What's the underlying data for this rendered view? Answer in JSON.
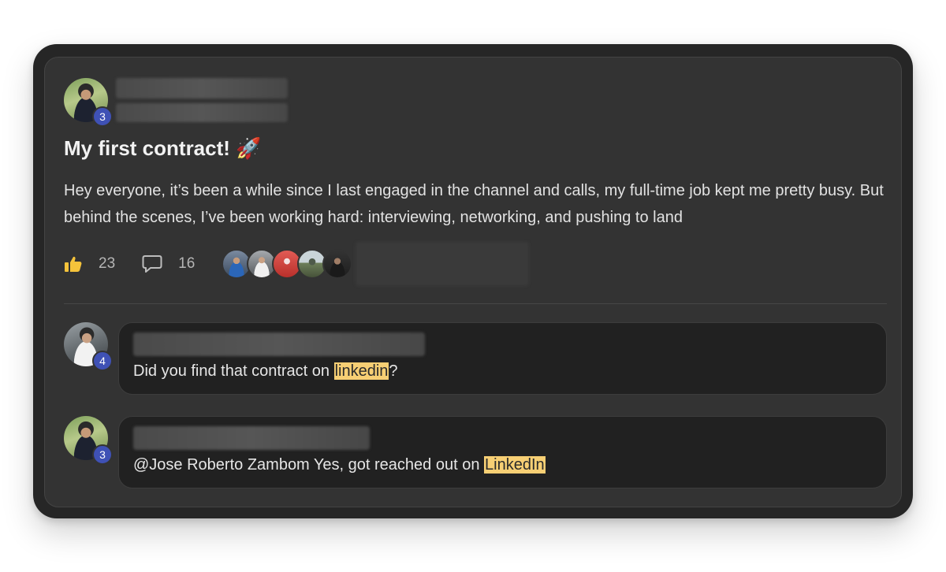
{
  "post": {
    "author_badge": "3",
    "title": "My first contract! 🚀",
    "body": "Hey everyone, it’s been a while since I last engaged in the channel and calls, my full-time job kept me pretty busy. But behind the scenes, I’ve been working hard: interviewing, networking, and pushing to land",
    "likes": "23",
    "comments": "16",
    "icons": [
      "thumbs-up-icon",
      "comment-icon"
    ]
  },
  "comments": [
    {
      "badge": "4",
      "text_before": "Did you find that contract on ",
      "highlight": "linkedin",
      "text_after": "?"
    },
    {
      "badge": "3",
      "text_before": "@Jose Roberto Zambom Yes, got reached out on ",
      "highlight": "LinkedIn",
      "text_after": ""
    }
  ],
  "colors": {
    "device": "#262626",
    "card": "#333333",
    "comment_bg": "#212121",
    "badge": "#3f51b5",
    "highlight": "#f7cf74",
    "like_icon": "#f5c33b"
  }
}
